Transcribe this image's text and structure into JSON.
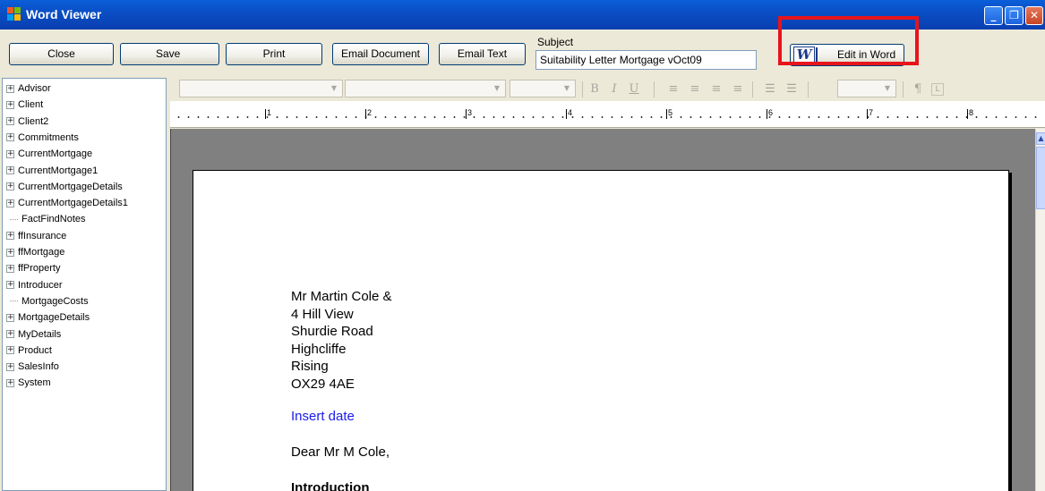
{
  "window": {
    "title": "Word Viewer",
    "minimize": "_",
    "restore": "❐",
    "close": "✕"
  },
  "toolbar": {
    "close_label": "Close",
    "save_label": "Save",
    "print_label": "Print",
    "email_document_label": "Email Document",
    "email_text_label": "Email Text",
    "subject_label": "Subject",
    "subject_value": "Suitability Letter Mortgage vOct09",
    "edit_in_word_label": "Edit in Word",
    "word_logo": "W",
    "highlight_color": "#e8141b"
  },
  "tree": {
    "items": [
      {
        "label": "Advisor",
        "expandable": true
      },
      {
        "label": "Client",
        "expandable": true
      },
      {
        "label": "Client2",
        "expandable": true
      },
      {
        "label": "Commitments",
        "expandable": true
      },
      {
        "label": "CurrentMortgage",
        "expandable": true
      },
      {
        "label": "CurrentMortgage1",
        "expandable": true
      },
      {
        "label": "CurrentMortgageDetails",
        "expandable": true
      },
      {
        "label": "CurrentMortgageDetails1",
        "expandable": true
      },
      {
        "label": "FactFindNotes",
        "expandable": false
      },
      {
        "label": "ffInsurance",
        "expandable": true
      },
      {
        "label": "ffMortgage",
        "expandable": true
      },
      {
        "label": "ffProperty",
        "expandable": true
      },
      {
        "label": "Introducer",
        "expandable": true
      },
      {
        "label": "MortgageCosts",
        "expandable": false
      },
      {
        "label": "MortgageDetails",
        "expandable": true
      },
      {
        "label": "MyDetails",
        "expandable": true
      },
      {
        "label": "Product",
        "expandable": true
      },
      {
        "label": "SalesInfo",
        "expandable": true
      },
      {
        "label": "System",
        "expandable": true
      }
    ],
    "expander_glyph": "+"
  },
  "format_bar": {
    "bold": "B",
    "italic": "I",
    "underline": "U",
    "pilcrow": "¶",
    "tab_stop": "L"
  },
  "ruler": {
    "marks": [
      "1",
      "2",
      "3",
      "4",
      "5",
      "6",
      "7",
      "8"
    ]
  },
  "document": {
    "address_lines": [
      "Mr Martin Cole &",
      "4 Hill View",
      "Shurdie Road",
      "Highcliffe",
      "Rising",
      "OX29 4AE"
    ],
    "insert_date": "Insert date",
    "salutation": "Dear Mr M Cole,",
    "heading": "Introduction",
    "insert_date_color": "#1a1aee"
  },
  "scrollbar": {
    "up_arrow": "▲"
  }
}
